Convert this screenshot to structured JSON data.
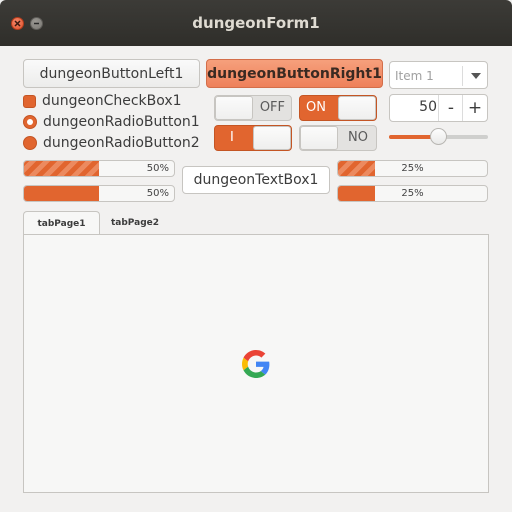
{
  "window": {
    "title": "dungeonForm1"
  },
  "buttons": {
    "left": "dungeonButtonLeft1",
    "right": "dungeonButtonRight1"
  },
  "combo": {
    "value": "Item 1"
  },
  "checkbox": {
    "label": "dungeonCheckBox1"
  },
  "radio1": {
    "label": "dungeonRadioButton1"
  },
  "radio2": {
    "label": "dungeonRadioButton2"
  },
  "switches": {
    "off_label": "OFF",
    "on_label": "ON",
    "i_label": "I",
    "no_label": "NO"
  },
  "spinner": {
    "value": "50",
    "minus": "-",
    "plus": "+"
  },
  "slider": {
    "value_fraction": 0.5
  },
  "progress": {
    "left1": {
      "value": 50,
      "label": "50%"
    },
    "left2": {
      "value": 50,
      "label": "50%"
    },
    "right1": {
      "value": 25,
      "label": "25%"
    },
    "right2": {
      "value": 25,
      "label": "25%"
    }
  },
  "textbox": {
    "value": "dungeonTextBox1"
  },
  "tabs": [
    {
      "label": "tabPage1"
    },
    {
      "label": "tabPage2"
    }
  ],
  "icons": {
    "close": "close-icon",
    "minimize": "minimize-icon",
    "logo": "google-logo-icon",
    "dropdown": "chevron-down-icon"
  },
  "colors": {
    "accent": "#e1652f",
    "titlebar": "#3c3b37"
  }
}
